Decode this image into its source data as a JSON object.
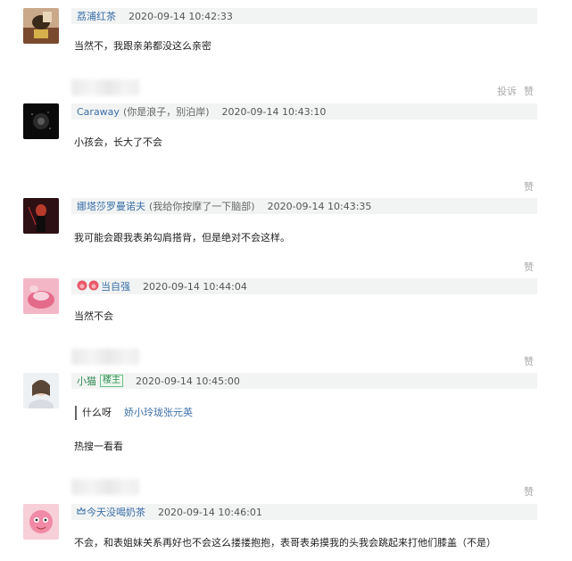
{
  "comments": [
    {
      "name": "荔浦红茶",
      "time": "2020-09-14 10:42:33",
      "text": "当然不，我跟亲弟都没这么亲密",
      "report": "投诉",
      "like": "赞"
    },
    {
      "name": "Caraway",
      "sig": "(你是浪子，别泊岸)",
      "time": "2020-09-14 10:43:10",
      "text": "小孩会，长大了不会",
      "like": "赞"
    },
    {
      "name": "娜塔莎罗曼诺夫",
      "sig": "(我给你按摩了一下脑部)",
      "time": "2020-09-14 10:43:35",
      "text": "我可能会跟我表弟勾肩搭背，但是绝对不会这样。",
      "like": "赞"
    },
    {
      "name": "当自强",
      "time": "2020-09-14 10:44:04",
      "text": "当然不会",
      "like": "赞"
    },
    {
      "name": "小猫",
      "badge": "楼主",
      "time": "2020-09-14 10:45:00",
      "quote_text": "什么呀",
      "quote_name": "娇小玲珑张元英",
      "text": "热搜一看看",
      "like": "赞"
    },
    {
      "name": "今天没喝奶茶",
      "time": "2020-09-14 10:46:01",
      "text": "不会，和表姐妹关系再好也不会这么搂搂抱抱，表哥表弟摸我的头我会跳起来打他们膝盖（不是）"
    }
  ]
}
